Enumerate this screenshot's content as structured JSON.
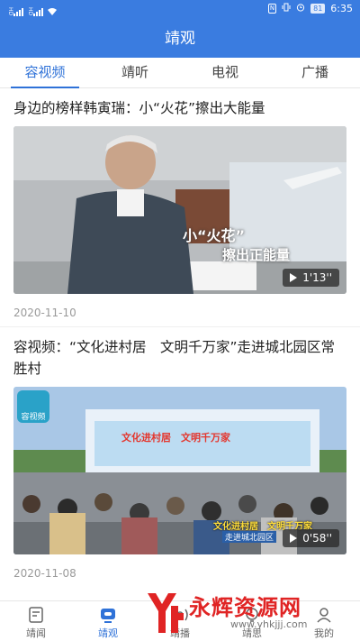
{
  "status_bar": {
    "signal_1": "HD",
    "signal_2": "HD",
    "nfc": "N",
    "battery": "81",
    "time": "6:35"
  },
  "app_bar": {
    "title": "靖观"
  },
  "tabs": [
    {
      "label": "容视频",
      "active": true
    },
    {
      "label": "靖听",
      "active": false
    },
    {
      "label": "电视",
      "active": false
    },
    {
      "label": "广播",
      "active": false
    }
  ],
  "feed": [
    {
      "title": "身边的榜样韩寅瑞：小“火花”擦出大能量",
      "overlay_line1": "小“火花”",
      "overlay_line2": "擦出正能量",
      "duration": "1'13''",
      "date": "2020-11-10"
    },
    {
      "title": "容视频：“文化进村居　文明千万家”走进城北园区常胜村",
      "logo_text": "容视频",
      "stage_banner": "文化进村居　文明千万家",
      "overlay_line1": "文化进村居　文明千万家",
      "overlay_line2": "走进城北园区",
      "duration": "0'58''",
      "date": "2020-11-08"
    }
  ],
  "bottom_nav": [
    {
      "label": "靖闻",
      "icon": "news-icon",
      "active": false
    },
    {
      "label": "靖观",
      "icon": "tv-icon",
      "active": true
    },
    {
      "label": "靖播",
      "icon": "broadcast-icon",
      "active": false
    },
    {
      "label": "靖思",
      "icon": "think-icon",
      "active": false
    },
    {
      "label": "我的",
      "icon": "profile-icon",
      "active": false
    }
  ],
  "watermark": {
    "text": "永辉资源网",
    "url": "www.yhkjjj.com"
  },
  "colors": {
    "primary": "#3a7ce0",
    "accent": "#2f72d8",
    "watermark": "#e02424"
  }
}
